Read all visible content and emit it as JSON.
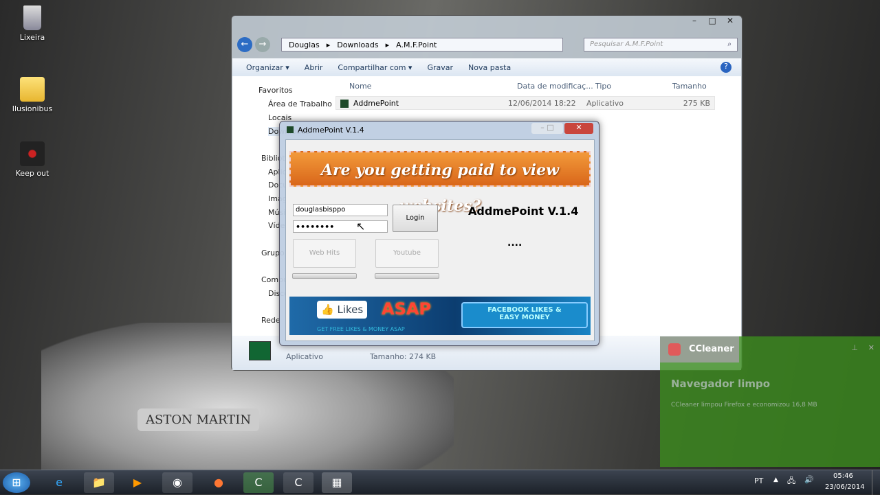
{
  "desktop": {
    "icons": [
      {
        "label": "Lixeira",
        "icon": "recycle-bin-icon"
      },
      {
        "label": "Ilusionibus",
        "icon": "folder-icon"
      },
      {
        "label": "Keep out",
        "icon": "keep-out-icon"
      }
    ],
    "car_badge": "ASTON MARTIN"
  },
  "explorer": {
    "breadcrumb": [
      "Douglas",
      "Downloads",
      "A.M.F.Point"
    ],
    "search_placeholder": "Pesquisar A.M.F.Point",
    "toolbar": {
      "organize": "Organizar ▾",
      "open": "Abrir",
      "share": "Compartilhar com ▾",
      "burn": "Gravar",
      "new_folder": "Nova pasta"
    },
    "nav": [
      "Favoritos",
      "Área de Trabalho",
      "Locais",
      "Downloads",
      "Bibliotecas",
      "Aplicativos",
      "Documentos",
      "Imagens",
      "Músicas",
      "Vídeos",
      "Grupo Doméstico",
      "Computador",
      "Disco Local",
      "Rede"
    ],
    "columns": [
      "Nome",
      "Data de modificaç...",
      "Tipo",
      "Tamanho"
    ],
    "files": [
      {
        "name": "AddmePoint",
        "date": "12/06/2014 18:22",
        "type": "Aplicativo",
        "size": "275 KB"
      }
    ],
    "details": {
      "type": "Aplicativo",
      "size": "Tamanho: 274 KB"
    }
  },
  "dialog": {
    "title": "AddmePoint V.1.4",
    "banner": "Are you getting paid to view websites?",
    "username": "douglasbisppo",
    "password": "••••••••",
    "login": "Login",
    "web_hits": "Web Hits",
    "youtube": "Youtube",
    "app_name": "AddmePoint V.1.4",
    "status": "....",
    "ad": {
      "likes": "Likes",
      "asap": "ASAP",
      "tagline": "GET FREE LIKES & MONEY ASAP",
      "right": "FACEBOOK LIKES & EASY MONEY"
    }
  },
  "notification": {
    "app": "CCleaner",
    "title": "Navegador limpo",
    "message": "CCleaner limpou Firefox e economizou 16,8 MB"
  },
  "taskbar": {
    "lang": "PT",
    "time": "05:46",
    "date": "23/06/2014"
  }
}
